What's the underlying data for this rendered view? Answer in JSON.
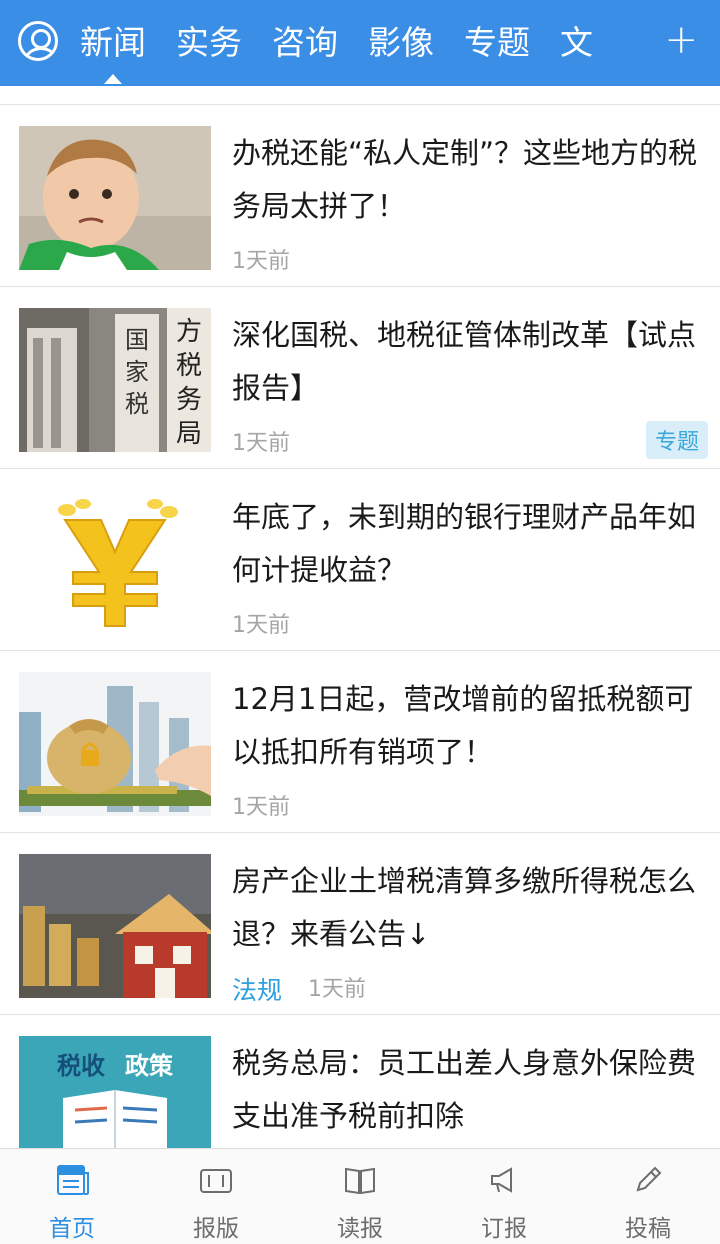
{
  "header": {
    "tabs": [
      "新闻",
      "实务",
      "咨询",
      "影像",
      "专题",
      "文"
    ],
    "plus": "+"
  },
  "articles": [
    {
      "title": "办税还能“私人定制”？这些地方的税务局太拼了！",
      "time": "1天前",
      "tag": "",
      "badge": ""
    },
    {
      "title": "深化国税、地税征管体制改革【试点报告】",
      "time": "1天前",
      "tag": "",
      "badge": "专题"
    },
    {
      "title": "年底了，未到期的银行理财产品年如何计提收益？",
      "time": "1天前",
      "tag": "",
      "badge": ""
    },
    {
      "title": "12月1日起，营改增前的留抵税额可以抵扣所有销项了！",
      "time": "1天前",
      "tag": "",
      "badge": ""
    },
    {
      "title": "房产企业土增税清算多缴所得税怎么退？来看公告↓",
      "time": "1天前",
      "tag": "法规",
      "badge": ""
    },
    {
      "title": "税务总局：员工出差人身意外保险费支出准予税前扣除",
      "time": "",
      "tag": "",
      "badge": "",
      "thumb_text_1": "税收",
      "thumb_text_2": "政策"
    }
  ],
  "bottom_nav": [
    {
      "label": "首页",
      "icon": "news-icon"
    },
    {
      "label": "报版",
      "icon": "newspaper-layout-icon"
    },
    {
      "label": "读报",
      "icon": "open-book-icon"
    },
    {
      "label": "订报",
      "icon": "megaphone-icon"
    },
    {
      "label": "投稿",
      "icon": "pencil-icon"
    }
  ],
  "colors": {
    "accent": "#3a8ee6",
    "tag": "#2f9fe0",
    "badge_bg": "#d9eef8"
  }
}
